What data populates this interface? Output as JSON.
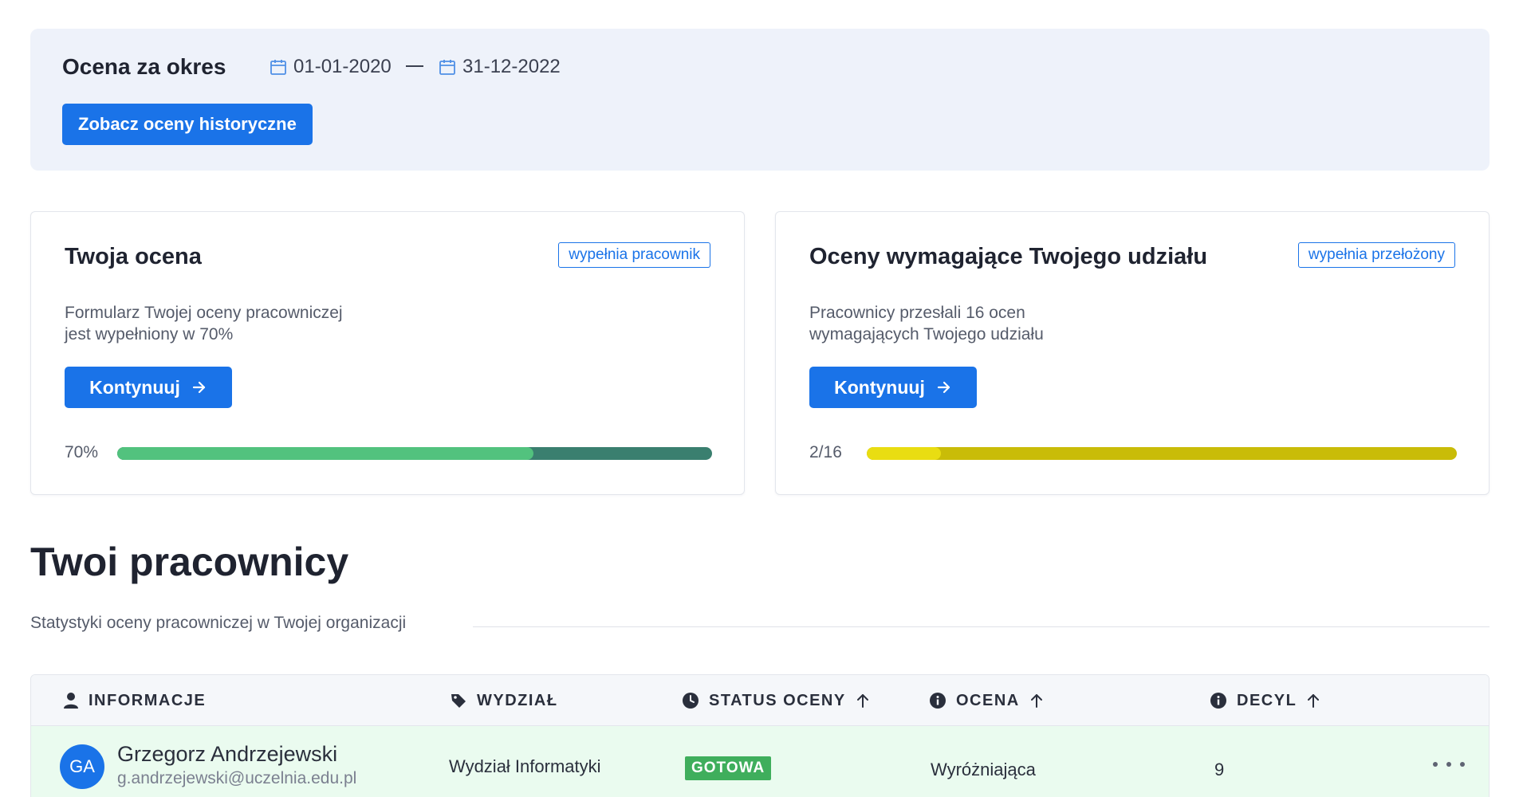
{
  "period": {
    "title": "Ocena za okres",
    "date_from": "01-01-2020",
    "date_to": "31-12-2022",
    "history_button": "Zobacz oceny historyczne"
  },
  "cards": {
    "own": {
      "title": "Twoja ocena",
      "badge": "wypełnia pracownik",
      "desc_line1": "Formularz Twojej oceny pracowniczej",
      "desc_line2": "jest wypełniony w 70%",
      "button": "Kontynuuj",
      "progress_label": "70%",
      "progress_fraction": 0.7
    },
    "required": {
      "title": "Oceny wymagające Twojego udziału",
      "badge": "wypełnia przełożony",
      "desc_line1": "Pracownicy przesłali 16 ocen",
      "desc_line2": "wymagających Twojego udziału",
      "button": "Kontynuuj",
      "progress_label": "2/16",
      "progress_fraction": 0.125
    }
  },
  "section": {
    "title": "Twoi pracownicy",
    "subtitle": "Statystyki oceny pracowniczej w Twojej organizacji"
  },
  "table": {
    "columns": {
      "info": "INFORMACJE",
      "department": "WYDZIAŁ",
      "status": "STATUS OCENY",
      "rating": "OCENA",
      "decile": "DECYL"
    },
    "rows": [
      {
        "initials": "GA",
        "name": "Grzegorz Andrzejewski",
        "email": "g.andrzejewski@uczelnia.edu.pl",
        "department": "Wydział Informatyki",
        "status": "GOTOWA",
        "rating": "Wyróżniająca",
        "decile": "9"
      }
    ]
  },
  "colors": {
    "accent": "#1a73e8",
    "banner_bg": "#eef2fa",
    "progress_own_fill": "#52c27e",
    "progress_own_track": "#3a7f6f",
    "progress_required_fill": "#e9dd12",
    "progress_required_track": "#c9bc08",
    "status_ready": "#3fae5c",
    "row_highlight": "#eafbef"
  },
  "icons": {
    "calendar": "calendar-icon",
    "arrow": "arrow-right-icon",
    "user": "user-icon",
    "department": "tag-icon",
    "status": "clock-icon",
    "info": "info-icon",
    "sort": "arrow-up-icon",
    "more": "more-horizontal-icon"
  }
}
